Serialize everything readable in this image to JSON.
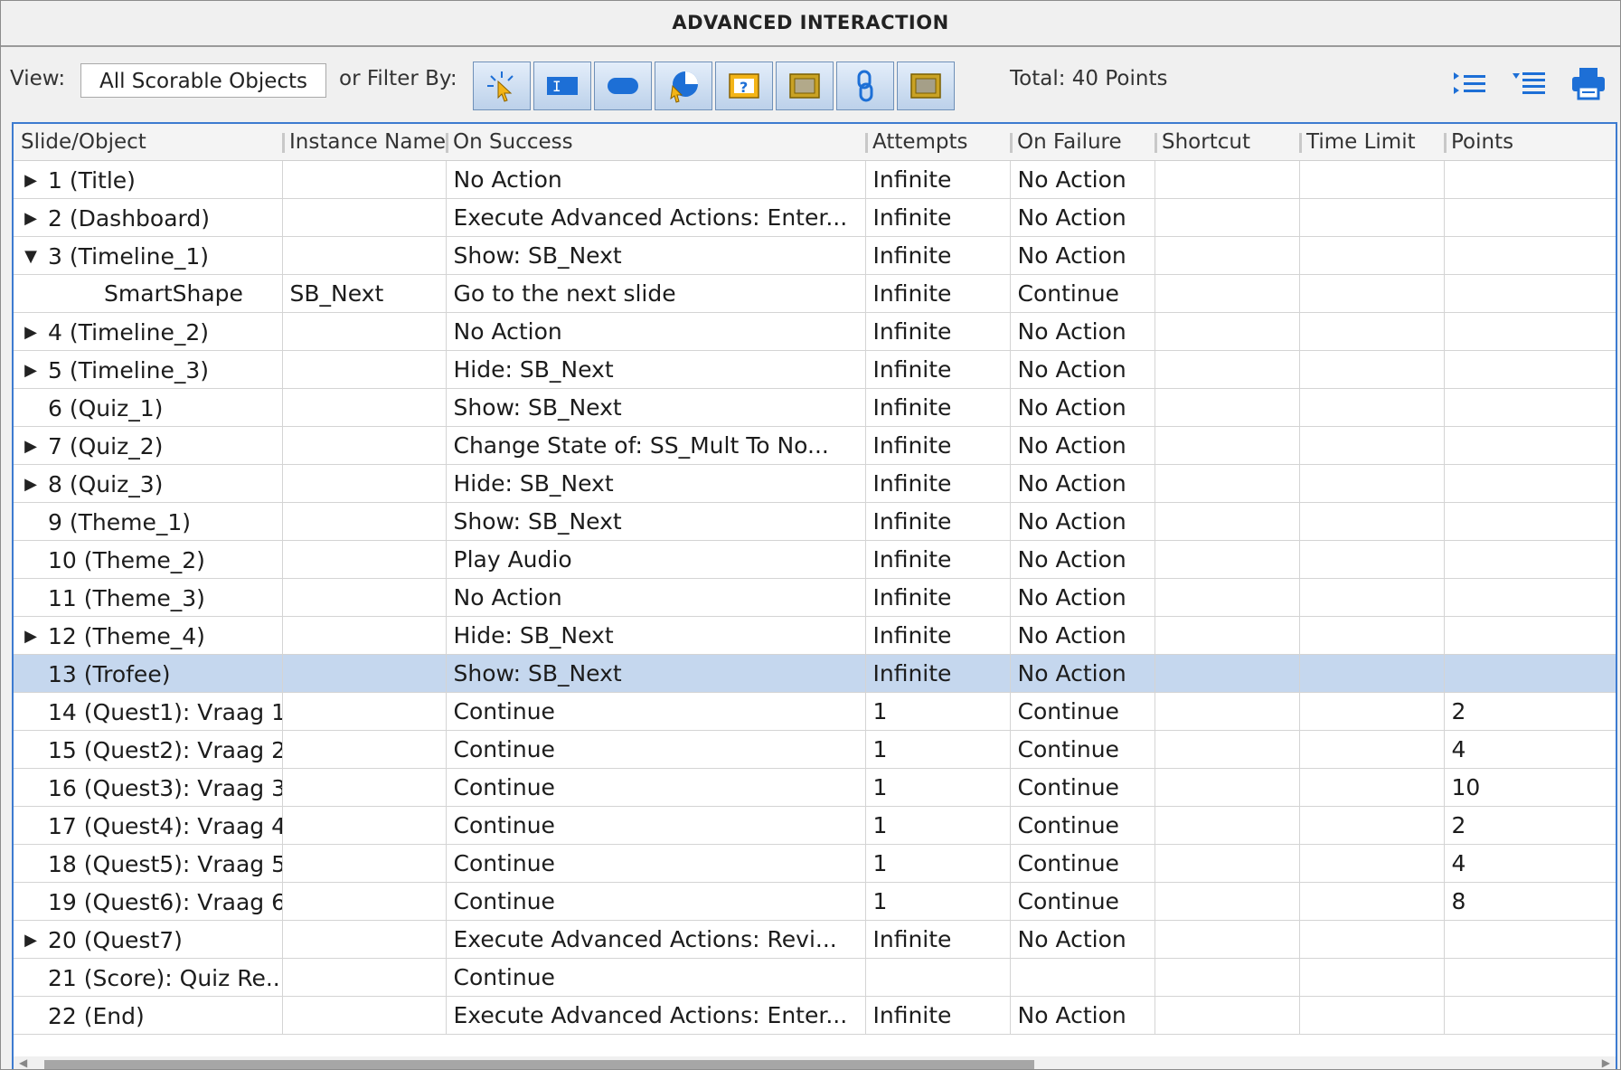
{
  "title": "ADVANCED INTERACTION",
  "toolbar": {
    "view_label": "View:",
    "view_value": "All Scorable Objects",
    "filter_label": "or Filter By:",
    "filter_buttons": [
      "click-box-icon",
      "text-entry-box-icon",
      "button-icon",
      "rollover-icon",
      "question-icon",
      "smartshape-icon",
      "hyperlink-icon",
      "image-icon"
    ],
    "total": "Total: 40 Points",
    "right_icons": [
      "expand-all-icon",
      "collapse-all-icon",
      "print-icon"
    ]
  },
  "colors": {
    "accent": "#3d7bd0",
    "selected_row": "#c5d7ee",
    "icon_blue": "#1d6fd6",
    "filter_yellow": "#e8b400"
  },
  "columns": [
    "Slide/Object",
    "Instance Name",
    "On Success",
    "Attempts",
    "On Failure",
    "Shortcut",
    "Time Limit",
    "Points"
  ],
  "rows": [
    {
      "expander": "▶",
      "slide": "1 (Title)",
      "instance": "",
      "success": "No Action",
      "attempts": "Infinite",
      "failure": "No Action",
      "shortcut": "",
      "time_limit": "",
      "points": ""
    },
    {
      "expander": "▶",
      "slide": "2 (Dashboard)",
      "instance": "",
      "success": "Execute Advanced Actions: Enter...",
      "attempts": "Infinite",
      "failure": "No Action",
      "shortcut": "",
      "time_limit": "",
      "points": ""
    },
    {
      "expander": "▼",
      "slide": "3 (Timeline_1)",
      "instance": "",
      "success": "Show: SB_Next",
      "attempts": "Infinite",
      "failure": "No Action",
      "shortcut": "",
      "time_limit": "",
      "points": ""
    },
    {
      "expander": "",
      "child": true,
      "slide": "SmartShape",
      "instance": "SB_Next",
      "success": "Go to the next slide",
      "attempts": "Infinite",
      "failure": "Continue",
      "shortcut": "",
      "time_limit": "",
      "points": ""
    },
    {
      "expander": "▶",
      "slide": "4 (Timeline_2)",
      "instance": "",
      "success": "No Action",
      "attempts": "Infinite",
      "failure": "No Action",
      "shortcut": "",
      "time_limit": "",
      "points": ""
    },
    {
      "expander": "▶",
      "slide": "5 (Timeline_3)",
      "instance": "",
      "success": "Hide: SB_Next",
      "attempts": "Infinite",
      "failure": "No Action",
      "shortcut": "",
      "time_limit": "",
      "points": ""
    },
    {
      "expander": "",
      "slide": "6 (Quiz_1)",
      "instance": "",
      "success": "Show: SB_Next",
      "attempts": "Infinite",
      "failure": "No Action",
      "shortcut": "",
      "time_limit": "",
      "points": ""
    },
    {
      "expander": "▶",
      "slide": "7 (Quiz_2)",
      "instance": "",
      "success": "Change State of: SS_Mult To No...",
      "attempts": "Infinite",
      "failure": "No Action",
      "shortcut": "",
      "time_limit": "",
      "points": ""
    },
    {
      "expander": "▶",
      "slide": "8 (Quiz_3)",
      "instance": "",
      "success": "Hide: SB_Next",
      "attempts": "Infinite",
      "failure": "No Action",
      "shortcut": "",
      "time_limit": "",
      "points": ""
    },
    {
      "expander": "",
      "slide": "9 (Theme_1)",
      "instance": "",
      "success": "Show: SB_Next",
      "attempts": "Infinite",
      "failure": "No Action",
      "shortcut": "",
      "time_limit": "",
      "points": ""
    },
    {
      "expander": "",
      "slide": "10 (Theme_2)",
      "instance": "",
      "success": "Play Audio",
      "attempts": "Infinite",
      "failure": "No Action",
      "shortcut": "",
      "time_limit": "",
      "points": ""
    },
    {
      "expander": "",
      "slide": "11 (Theme_3)",
      "instance": "",
      "success": "No Action",
      "attempts": "Infinite",
      "failure": "No Action",
      "shortcut": "",
      "time_limit": "",
      "points": ""
    },
    {
      "expander": "▶",
      "slide": "12 (Theme_4)",
      "instance": "",
      "success": "Hide: SB_Next",
      "attempts": "Infinite",
      "failure": "No Action",
      "shortcut": "",
      "time_limit": "",
      "points": ""
    },
    {
      "expander": "",
      "selected": true,
      "slide": "13 (Trofee)",
      "instance": "",
      "success": "Show: SB_Next",
      "attempts": "Infinite",
      "failure": "No Action",
      "shortcut": "",
      "time_limit": "",
      "points": ""
    },
    {
      "expander": "",
      "slide": "14 (Quest1): Vraag 1",
      "instance": "",
      "success": "Continue",
      "attempts": "1",
      "failure": "Continue",
      "shortcut": "",
      "time_limit": "",
      "points": "2"
    },
    {
      "expander": "",
      "slide": "15 (Quest2): Vraag 2",
      "instance": "",
      "success": "Continue",
      "attempts": "1",
      "failure": "Continue",
      "shortcut": "",
      "time_limit": "",
      "points": "4"
    },
    {
      "expander": "",
      "slide": "16 (Quest3): Vraag 3",
      "instance": "",
      "success": "Continue",
      "attempts": "1",
      "failure": "Continue",
      "shortcut": "",
      "time_limit": "",
      "points": "10"
    },
    {
      "expander": "",
      "slide": "17 (Quest4): Vraag 4",
      "instance": "",
      "success": "Continue",
      "attempts": "1",
      "failure": "Continue",
      "shortcut": "",
      "time_limit": "",
      "points": "2"
    },
    {
      "expander": "",
      "slide": "18 (Quest5): Vraag 5",
      "instance": "",
      "success": "Continue",
      "attempts": "1",
      "failure": "Continue",
      "shortcut": "",
      "time_limit": "",
      "points": "4"
    },
    {
      "expander": "",
      "slide": "19 (Quest6): Vraag 6",
      "instance": "",
      "success": "Continue",
      "attempts": "1",
      "failure": "Continue",
      "shortcut": "",
      "time_limit": "",
      "points": "8"
    },
    {
      "expander": "▶",
      "slide": "20 (Quest7)",
      "instance": "",
      "success": "Execute Advanced Actions: Revi...",
      "attempts": "Infinite",
      "failure": "No Action",
      "shortcut": "",
      "time_limit": "",
      "points": ""
    },
    {
      "expander": "",
      "slide": "21 (Score): Quiz Re...",
      "instance": "",
      "success": "Continue",
      "attempts": "",
      "failure": "",
      "shortcut": "",
      "time_limit": "",
      "points": ""
    },
    {
      "expander": "",
      "slide": "22 (End)",
      "instance": "",
      "success": "Execute Advanced Actions: Enter...",
      "attempts": "Infinite",
      "failure": "No Action",
      "shortcut": "",
      "time_limit": "",
      "points": ""
    }
  ]
}
